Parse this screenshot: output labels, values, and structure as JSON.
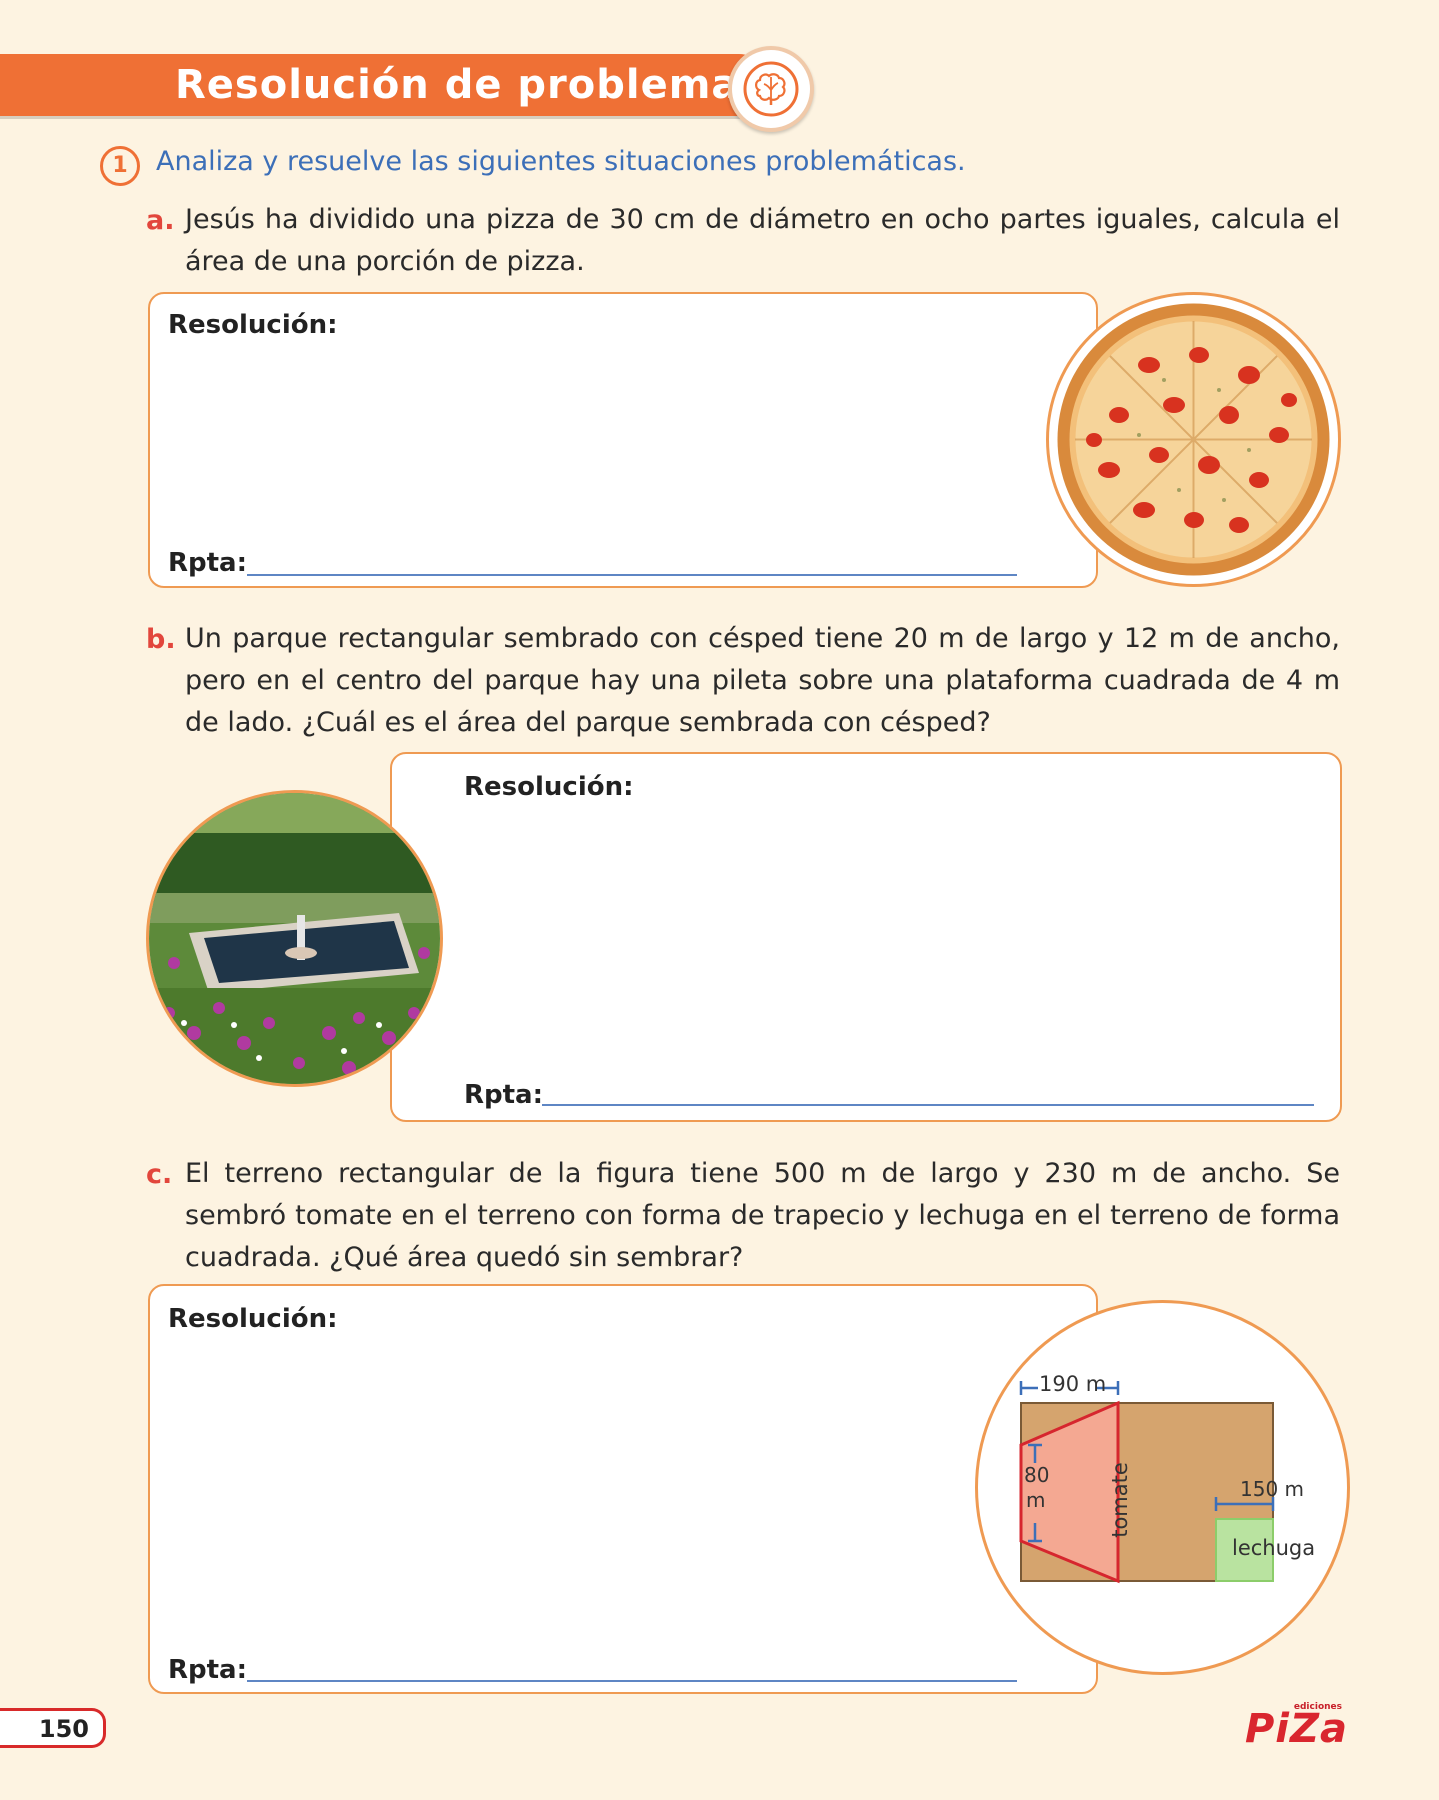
{
  "header": {
    "title": "Resolución de problemas",
    "badge_icon": "brain-icon"
  },
  "exercise": {
    "number": "1",
    "instruction": "Analiza y resuelve las siguientes situaciones problemáticas."
  },
  "problems": [
    {
      "letter": "a.",
      "text": "Jesús ha dividido una pizza de 30 cm de diámetro en ocho partes iguales, calcula el área de una porción de pizza.",
      "box_title": "Resolución:",
      "answer_label": "Rpta:",
      "image": "pizza-photo"
    },
    {
      "letter": "b.",
      "text": "Un parque rectangular sembrado con césped tiene 20 m de largo y 12 m de ancho, pero en el centro del parque hay una pileta sobre una plataforma cuadrada de 4 m de lado. ¿Cuál es el área del parque sembrada con césped?",
      "box_title": "Resolución:",
      "answer_label": "Rpta:",
      "image": "fountain-garden-photo"
    },
    {
      "letter": "c.",
      "text": "El terreno rectangular de la figura tiene 500 m de largo y 230 m de ancho. Se sembró tomate en el terreno con forma de trapecio y lechuga en el terreno de forma cuadrada. ¿Qué área quedó sin sembrar?",
      "box_title": "Resolución:",
      "answer_label": "Rpta:",
      "figure": {
        "top_dimension": "190 m",
        "left_dimension_1": "80",
        "left_dimension_2": "m",
        "trapezoid_label": "tomate",
        "square_dimension": "150 m",
        "square_label": "lechuga",
        "colors": {
          "field": "#d5a46e",
          "trapezoid": "#f4a892",
          "square": "#b9e3a0",
          "measure": "#3c6fb8"
        }
      }
    }
  ],
  "footer": {
    "page_number": "150",
    "brand_small": "ediciones",
    "brand_name": "PiZa"
  }
}
